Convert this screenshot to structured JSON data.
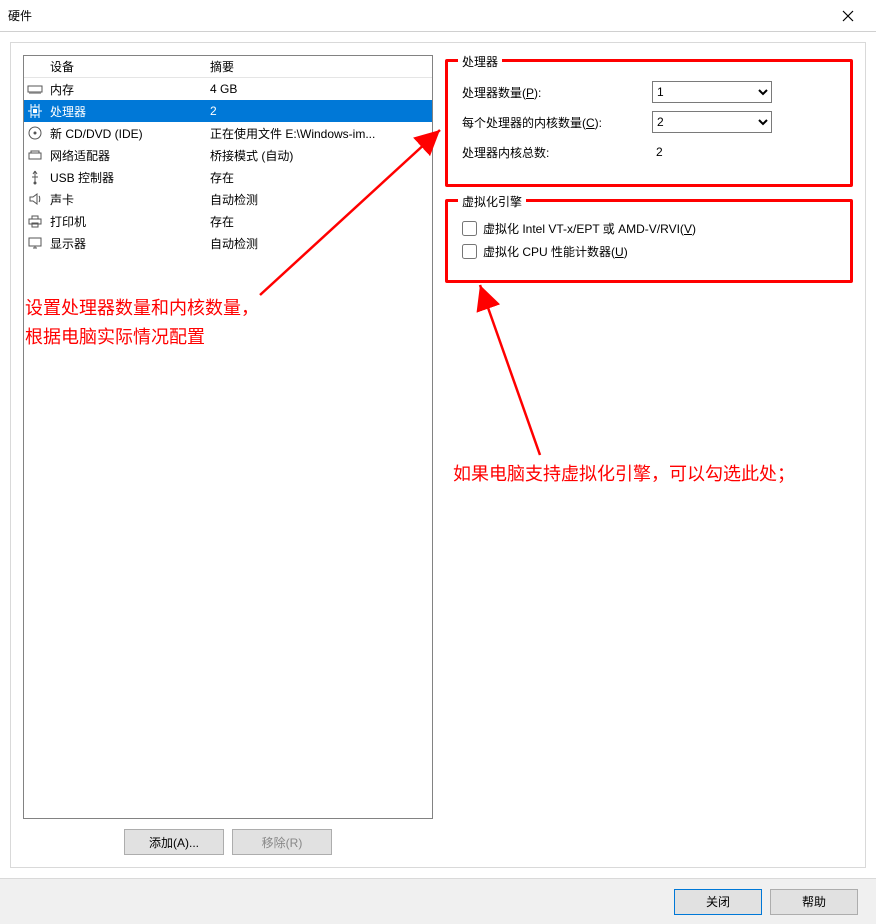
{
  "window": {
    "title": "硬件"
  },
  "device_list": {
    "header_device": "设备",
    "header_summary": "摘要",
    "items": [
      {
        "icon": "memory",
        "name": "内存",
        "summary": "4 GB",
        "selected": false
      },
      {
        "icon": "cpu",
        "name": "处理器",
        "summary": "2",
        "selected": true
      },
      {
        "icon": "cd",
        "name": "新 CD/DVD (IDE)",
        "summary": "正在使用文件 E:\\Windows-im...",
        "selected": false
      },
      {
        "icon": "nic",
        "name": "网络适配器",
        "summary": "桥接模式 (自动)",
        "selected": false
      },
      {
        "icon": "usb",
        "name": "USB 控制器",
        "summary": "存在",
        "selected": false
      },
      {
        "icon": "sound",
        "name": "声卡",
        "summary": "自动检测",
        "selected": false
      },
      {
        "icon": "printer",
        "name": "打印机",
        "summary": "存在",
        "selected": false
      },
      {
        "icon": "display",
        "name": "显示器",
        "summary": "自动检测",
        "selected": false
      }
    ]
  },
  "buttons": {
    "add": "添加(A)...",
    "remove": "移除(R)",
    "close": "关闭",
    "help": "帮助"
  },
  "processor_group": {
    "legend": "处理器",
    "num_proc_label_pre": "处理器数量(",
    "num_proc_key": "P",
    "num_proc_label_post": "):",
    "num_proc_value": "1",
    "cores_label_pre": "每个处理器的内核数量(",
    "cores_key": "C",
    "cores_label_post": "):",
    "cores_value": "2",
    "total_label": "处理器内核总数:",
    "total_value": "2"
  },
  "virt_group": {
    "legend": "虚拟化引擎",
    "option1_pre": "虚拟化 Intel VT-x/EPT 或 AMD-V/RVI(",
    "option1_key": "V",
    "option1_post": ")",
    "option2_pre": "虚拟化 CPU 性能计数器(",
    "option2_key": "U",
    "option2_post": ")"
  },
  "annotations": {
    "a1_line1": "设置处理器数量和内核数量，",
    "a1_line2": "根据电脑实际情况配置",
    "a2": "如果电脑支持虚拟化引擎，可以勾选此处；"
  }
}
